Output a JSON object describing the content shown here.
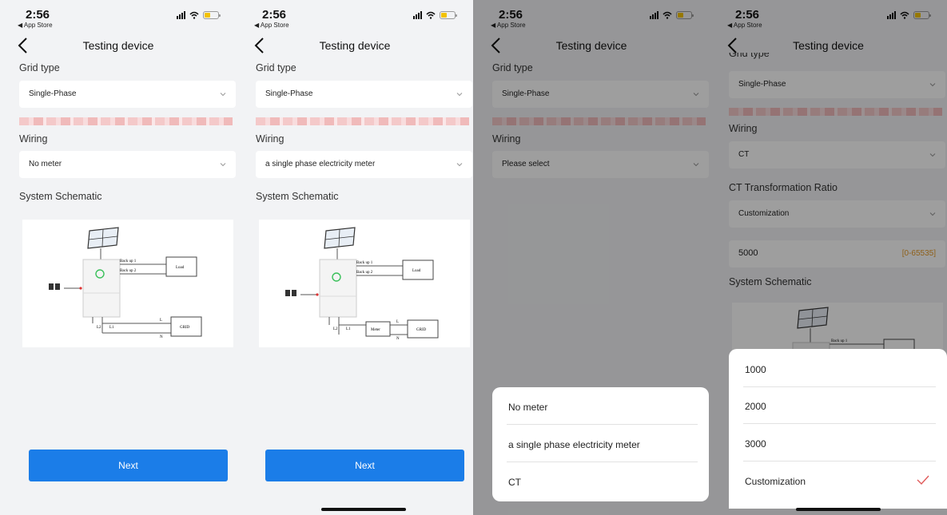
{
  "status": {
    "time": "2:56",
    "back_label": "◀ App Store"
  },
  "nav": {
    "title": "Testing device"
  },
  "labels": {
    "grid_type": "Grid type",
    "wiring": "Wiring",
    "system_schematic": "System Schematic",
    "ct_ratio": "CT Transformation Ratio"
  },
  "grid_type_value": "Single-Phase",
  "screens": [
    {
      "wiring_value": "No meter",
      "next_label": "Next"
    },
    {
      "wiring_value": "a single phase electricity meter",
      "next_label": "Next"
    },
    {
      "wiring_value": "Please select"
    },
    {
      "grid_type_label_partial": "Grid type",
      "wiring_value": "CT",
      "ratio_value": "Customization",
      "ratio_input_value": "5000",
      "ratio_range": "[0-65535]"
    }
  ],
  "schematic": {
    "backup1": "Back up 1",
    "backup2": "Back up 2",
    "load": "Load",
    "grid": "GRID",
    "meter": "Meter",
    "l": "L",
    "n": "N",
    "l2": "L2",
    "l1": "L1"
  },
  "wiring_sheet": {
    "options": [
      "No meter",
      "a single phase electricity meter",
      "CT"
    ]
  },
  "ratio_sheet": {
    "options": [
      "1000",
      "2000",
      "3000",
      "Customization"
    ],
    "selected": "Customization"
  },
  "colors": {
    "primary": "#1b7de8",
    "background": "#f2f3f5",
    "check": "#e05a5a",
    "range": "#e59b2a"
  }
}
